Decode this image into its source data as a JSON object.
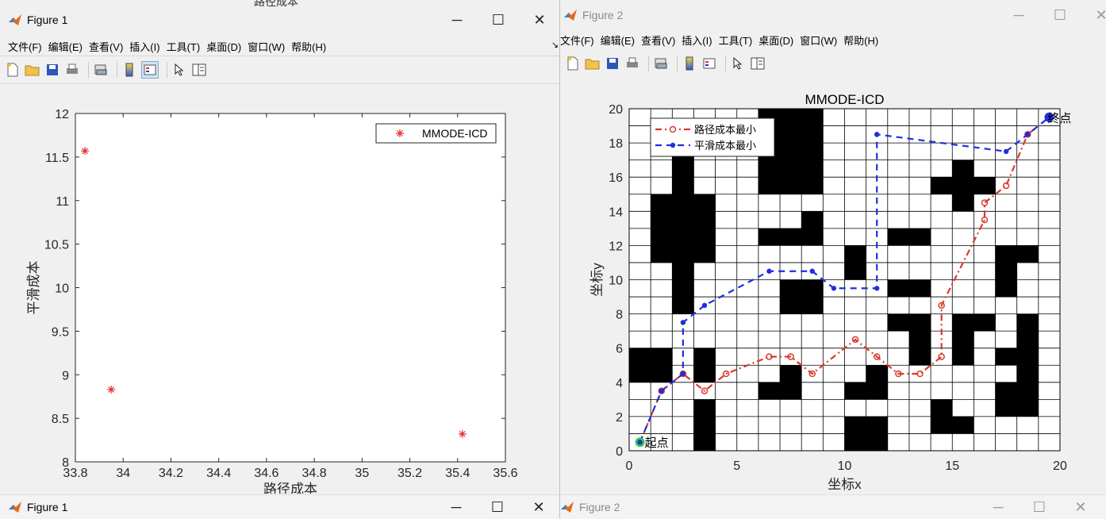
{
  "top_fragment_left": "路径成本",
  "top_fragment_right": "y",
  "fig1": {
    "title": "Figure 1",
    "controls": {
      "minimize": "─",
      "maximize": "☐",
      "close": "✕"
    },
    "menu": [
      "文件(F)",
      "编辑(E)",
      "查看(V)",
      "插入(I)",
      "工具(T)",
      "桌面(D)",
      "窗口(W)",
      "帮助(H)"
    ],
    "dock_arrow": "↘"
  },
  "fig2": {
    "title": "Figure 2",
    "controls": {
      "minimize": "─",
      "maximize": "☐",
      "close": "✕"
    },
    "menu": [
      "文件(F)",
      "编辑(E)",
      "查看(V)",
      "插入(I)",
      "工具(T)",
      "桌面(D)",
      "窗口(W)",
      "帮助(H)"
    ]
  },
  "fig1_bottom": {
    "title": "Figure 1",
    "controls": {
      "minimize": "─",
      "maximize": "☐",
      "close": "✕"
    }
  },
  "fig2_bottom": {
    "title": "Figure 2",
    "controls": {
      "minimize": "─",
      "maximize": "☐",
      "close": "✕"
    }
  },
  "toolbar_icons": [
    "new-file-icon",
    "open-folder-icon",
    "save-icon",
    "print-icon",
    "link-plot-icon",
    "colorbar-icon",
    "legend-icon",
    "pointer-icon",
    "property-inspector-icon"
  ],
  "chart_data": [
    {
      "type": "scatter",
      "title": "",
      "xlabel": "路径成本",
      "ylabel": "平滑成本",
      "xlim": [
        33.8,
        35.6
      ],
      "ylim": [
        8,
        12
      ],
      "xticks": [
        33.8,
        34,
        34.2,
        34.4,
        34.6,
        34.8,
        35,
        35.2,
        35.4,
        35.6
      ],
      "xtick_labels": [
        "33.8",
        "34",
        "34.2",
        "34.4",
        "34.6",
        "34.8",
        "35",
        "35.2",
        "35.4",
        "35.6"
      ],
      "yticks": [
        8,
        8.5,
        9,
        9.5,
        10,
        10.5,
        11,
        11.5,
        12
      ],
      "ytick_labels": [
        "8",
        "8.5",
        "9",
        "9.5",
        "10",
        "10.5",
        "11",
        "11.5",
        "12"
      ],
      "series": [
        {
          "name": "MMODE-ICD",
          "color": "#e03030",
          "marker": "asterisk",
          "x": [
            33.84,
            33.95,
            35.42
          ],
          "y": [
            11.57,
            8.83,
            8.32
          ]
        }
      ],
      "legend": "top-right",
      "grid": false
    },
    {
      "type": "line",
      "title": "MMODE-ICD",
      "xlabel": "坐标x",
      "ylabel": "坐标y",
      "xlim": [
        0,
        20
      ],
      "ylim": [
        0,
        20
      ],
      "xticks": [
        0,
        5,
        10,
        15,
        20
      ],
      "xtick_labels": [
        "0",
        "5",
        "10",
        "15",
        "20"
      ],
      "yticks": [
        0,
        2,
        4,
        6,
        8,
        10,
        12,
        14,
        16,
        18,
        20
      ],
      "ytick_labels": [
        "0",
        "2",
        "4",
        "6",
        "8",
        "10",
        "12",
        "14",
        "16",
        "18",
        "20"
      ],
      "grid": true,
      "legend": "top-left",
      "obstacles": [
        [
          0,
          4,
          2,
          6
        ],
        [
          3,
          0,
          4,
          3
        ],
        [
          3,
          4,
          4,
          6
        ],
        [
          6,
          3,
          7,
          4
        ],
        [
          7,
          3,
          8,
          5
        ],
        [
          10,
          3,
          11,
          4
        ],
        [
          11,
          3,
          12,
          5
        ],
        [
          10,
          0,
          12,
          2
        ],
        [
          14,
          1,
          15,
          3
        ],
        [
          15,
          1,
          16,
          2
        ],
        [
          17,
          2,
          19,
          4
        ],
        [
          18,
          4,
          19,
          8
        ],
        [
          17,
          5,
          18,
          6
        ],
        [
          13,
          5,
          14,
          8
        ],
        [
          12,
          7,
          13,
          8
        ],
        [
          15,
          5,
          16,
          8
        ],
        [
          16,
          7,
          17,
          8
        ],
        [
          12,
          9,
          14,
          10
        ],
        [
          10,
          10,
          11,
          12
        ],
        [
          12,
          12,
          14,
          13
        ],
        [
          14,
          15,
          17,
          16
        ],
        [
          15,
          14,
          16,
          17
        ],
        [
          17,
          9,
          18,
          12
        ],
        [
          18,
          11,
          19,
          12
        ],
        [
          7,
          8,
          9,
          10
        ],
        [
          6,
          12,
          9,
          13
        ],
        [
          8,
          13,
          9,
          14
        ],
        [
          6,
          15,
          9,
          20
        ],
        [
          6,
          20,
          9,
          20
        ],
        [
          1,
          11,
          4,
          15
        ],
        [
          2,
          8,
          3,
          11
        ],
        [
          2,
          15,
          3,
          18
        ],
        [
          6,
          18,
          9,
          20
        ]
      ],
      "series": [
        {
          "name": "路径成本最小",
          "color": "#d93a2b",
          "marker": "circle-open",
          "x": [
            0.5,
            1.5,
            2.5,
            3.5,
            4.5,
            6.5,
            7.5,
            8.5,
            10.5,
            11.5,
            12.5,
            13.5,
            14.5,
            14.5,
            16.5,
            16.5,
            17.5,
            18.5,
            19.5
          ],
          "y": [
            0.5,
            3.5,
            4.5,
            3.5,
            4.5,
            5.5,
            5.5,
            4.5,
            6.5,
            5.5,
            4.5,
            4.5,
            5.5,
            8.5,
            13.5,
            14.5,
            15.5,
            18.5,
            19.5
          ]
        },
        {
          "name": "平滑成本最小",
          "color": "#1f2fe0",
          "marker": "dot",
          "x": [
            0.5,
            1.5,
            2.5,
            2.5,
            3.5,
            6.5,
            8.5,
            9.5,
            11.5,
            11.5,
            17.5,
            18.5,
            19.5
          ],
          "y": [
            0.5,
            3.5,
            4.5,
            7.5,
            8.5,
            10.5,
            10.5,
            9.5,
            9.5,
            18.5,
            17.5,
            18.5,
            19.5
          ]
        }
      ],
      "annotations": [
        {
          "text": "起点",
          "x": 0.5,
          "y": 0.5
        },
        {
          "text": "终点",
          "x": 19.5,
          "y": 19.5
        }
      ]
    }
  ]
}
